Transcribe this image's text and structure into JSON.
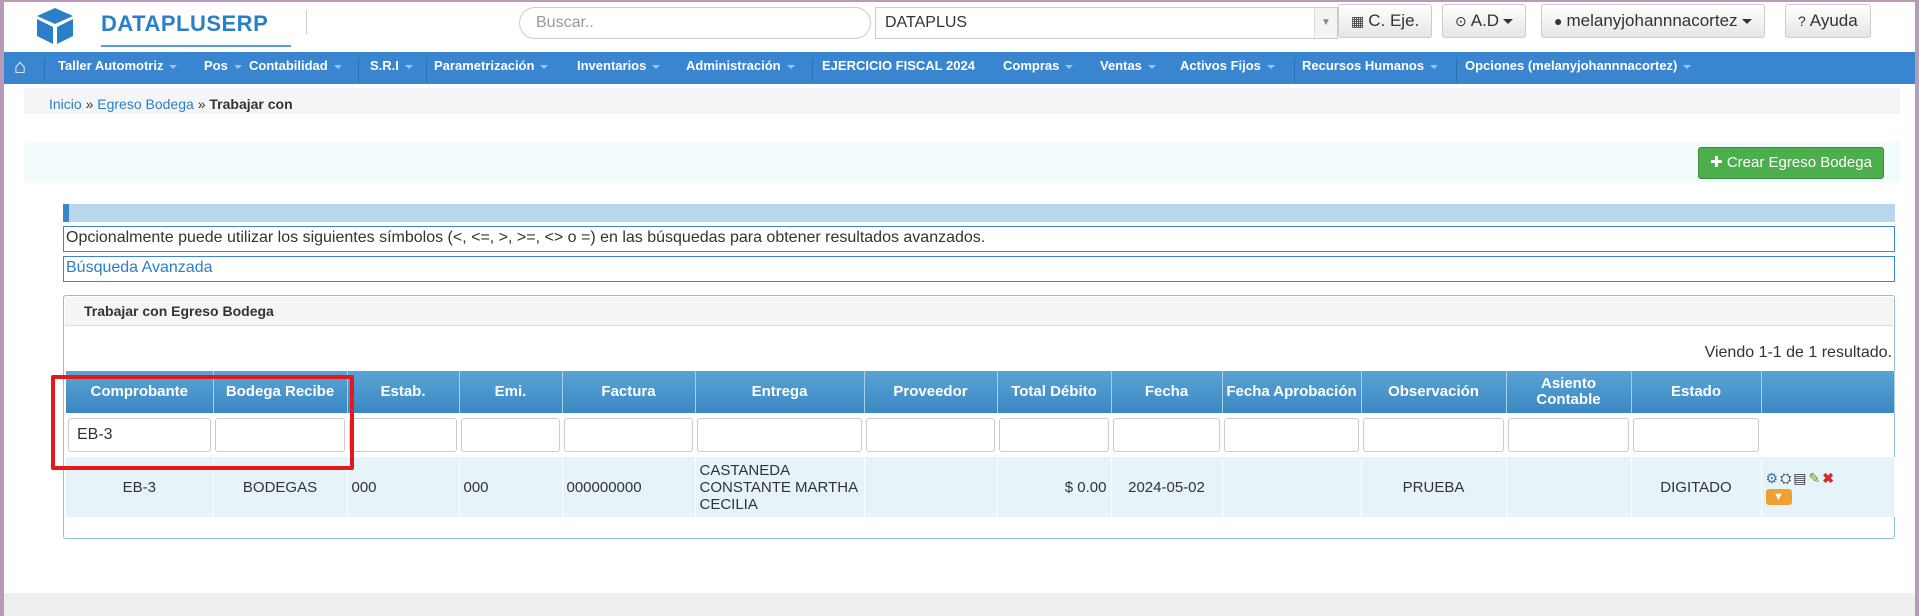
{
  "brand": {
    "name": "DATAPLUSERP"
  },
  "header": {
    "search_placeholder": "Buscar..",
    "company_value": "DATAPLUS",
    "buttons": {
      "ejercicio": "C. Eje.",
      "ad": "A.D",
      "user": "melanyjohannnacortez",
      "help": "Ayuda"
    }
  },
  "nav": {
    "items": [
      "Taller Automotriz",
      "Pos",
      "Contabilidad",
      "S.R.I",
      "Parametrización",
      "Inventarios",
      "Administración",
      "EJERCICIO FISCAL 2024",
      "Compras",
      "Ventas",
      "Activos Fijos",
      "Recursos Humanos",
      "Opciones (melanyjohannnacortez)"
    ]
  },
  "breadcrumb": {
    "home": "Inicio",
    "section": "Egreso Bodega",
    "sep": "»",
    "current": "Trabajar con"
  },
  "actions": {
    "create_label": "Crear Egreso Bodega"
  },
  "info": {
    "symbols_note": "Opcionalmente puede utilizar los siguientes símbolos (<, <=, >, >=, <> o =) en las búsquedas para obtener resultados avanzados.",
    "advanced_search": "Búsqueda Avanzada"
  },
  "panel": {
    "title": "Trabajar con Egreso Bodega",
    "summary": "Viendo 1-1 de 1 resultado."
  },
  "table": {
    "columns": [
      "Comprobante",
      "Bodega Recibe",
      "Estab.",
      "Emi.",
      "Factura",
      "Entrega",
      "Proveedor",
      "Total Débito",
      "Fecha",
      "Fecha Aprobación",
      "Observación",
      "Asiento Contable",
      "Estado",
      ""
    ],
    "filters": {
      "comprobante": "EB-3"
    },
    "rows": [
      {
        "comprobante": "EB-3",
        "bodega": "BODEGAS",
        "estab": "000",
        "emi": "000",
        "factura": "000000000",
        "entrega": "CASTANEDA CONSTANTE MARTHA CECILIA",
        "proveedor": "",
        "total": "$ 0.00",
        "fecha": "2024-05-02",
        "fecha_aprobacion": "",
        "observacion": "PRUEBA",
        "asiento": "",
        "estado": "DIGITADO"
      }
    ]
  },
  "colors": {
    "nav": "#3a85d0",
    "brand": "#2a7fc9",
    "create": "#4cae4c",
    "highlight": "#e4191e"
  }
}
